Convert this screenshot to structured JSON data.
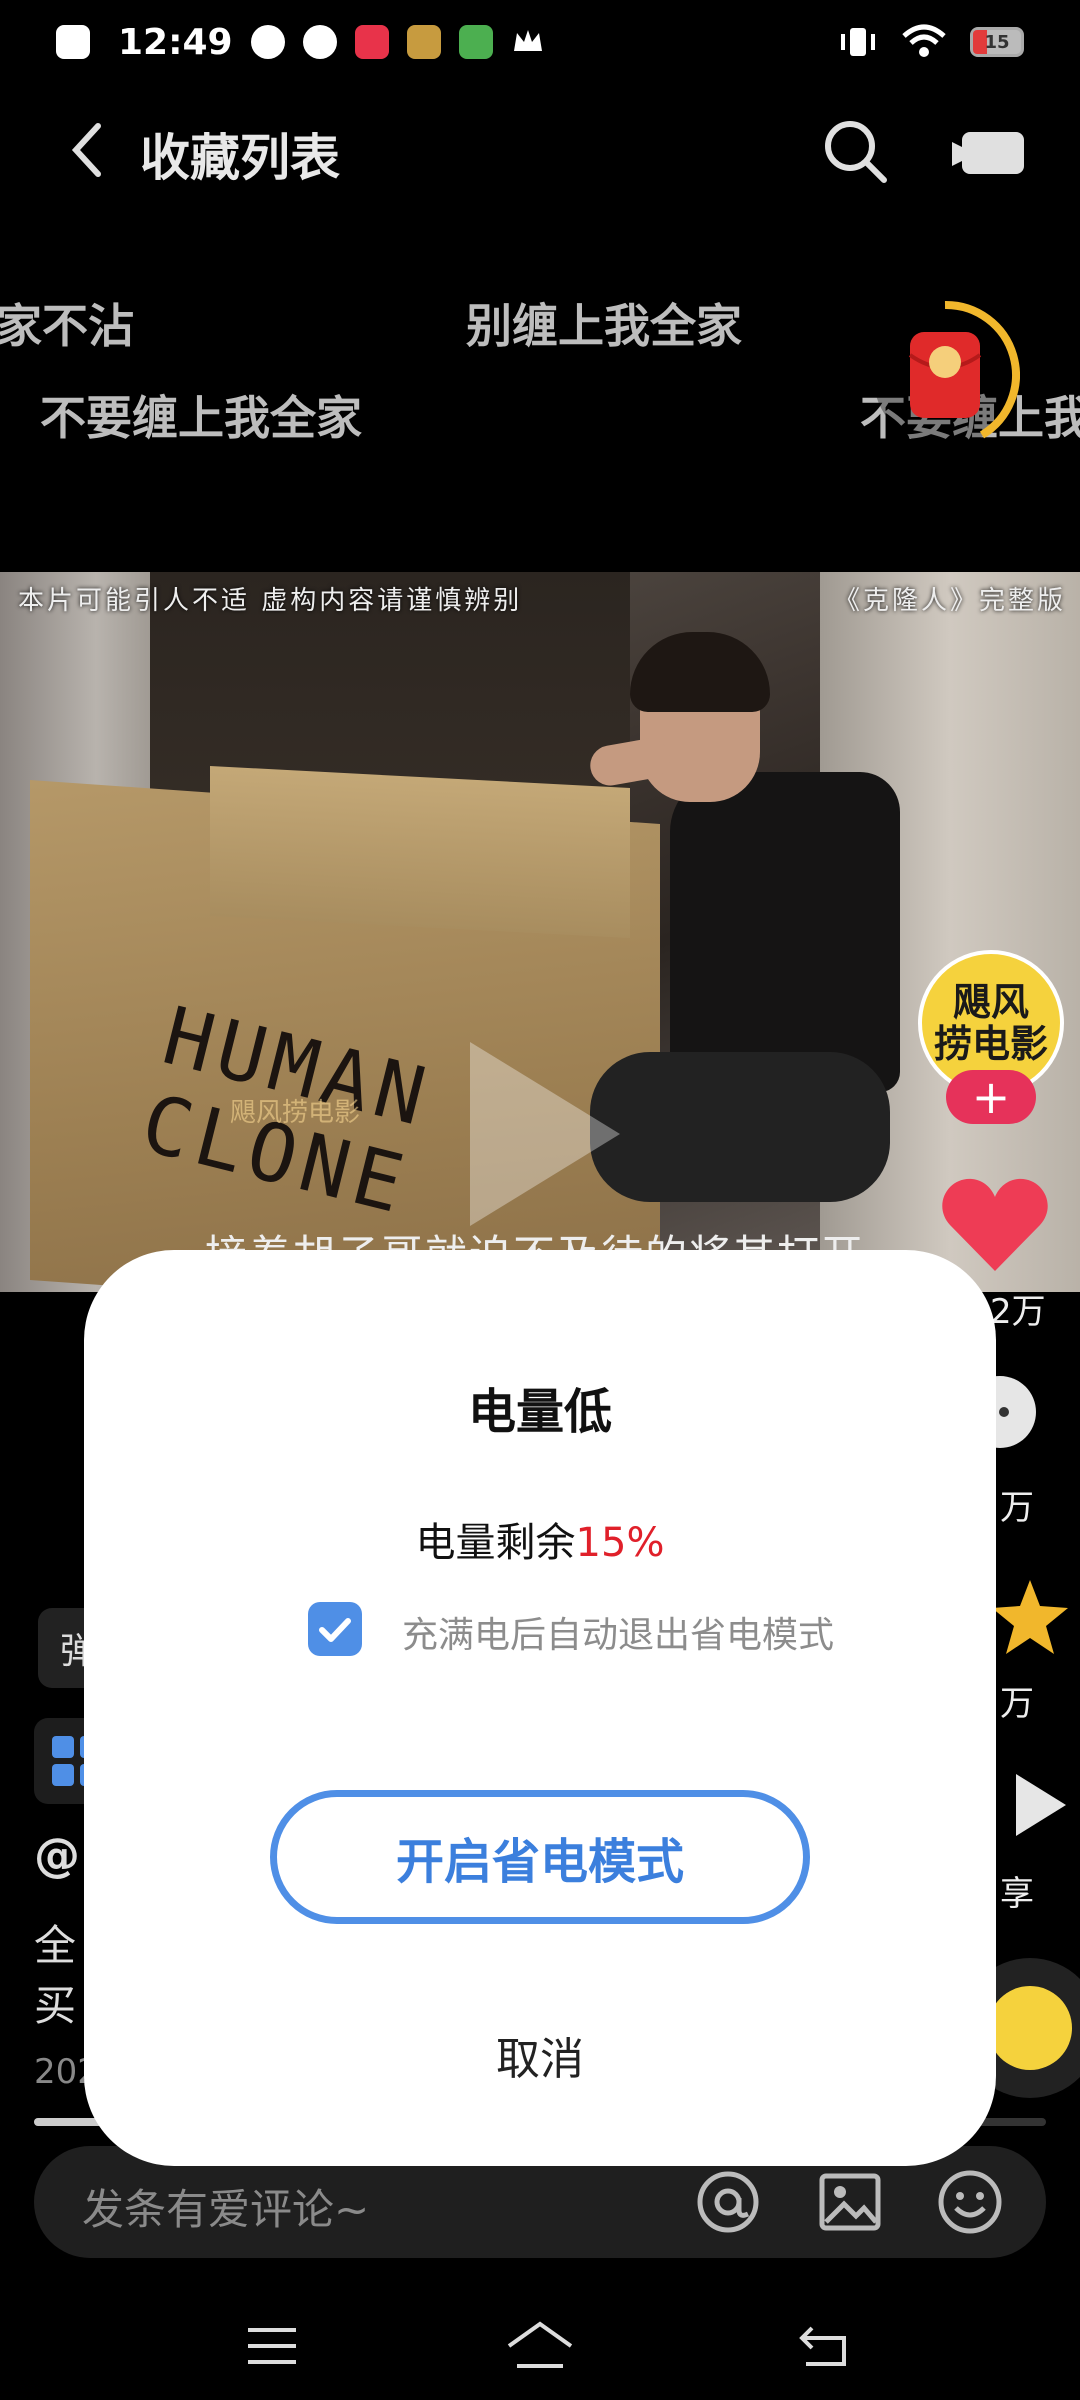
{
  "status_bar": {
    "time": "12:49",
    "battery_level": "15",
    "battery_color": "#e23b3b"
  },
  "header": {
    "title": "收藏列表",
    "back_icon": "chevron-left-icon",
    "search_icon": "search-icon",
    "camera_icon": "video-camera-icon"
  },
  "danmaku": [
    "家不沾",
    "别缠上我全家",
    "不要缠上我全家",
    "不要缠上我"
  ],
  "video": {
    "caption_left": "本片可能引人不适 虚构内容请谨慎辨别",
    "caption_right": "《克隆人》完整版",
    "box_text": "HUMAN CLONE",
    "watermark": "飓风捞电影",
    "subtitle": "接着胡子哥就迫不及待的将其打开"
  },
  "rail": {
    "avatar_text_1": "飓风",
    "avatar_text_2": "捞电影",
    "follow_label": "+",
    "like_count": "2万",
    "comment_count": "万",
    "favorite_count": "万",
    "share_label": "享"
  },
  "info": {
    "danmaku_label": "弹",
    "author": "@",
    "desc_line1": "全",
    "desc_line2": "买",
    "date": "202"
  },
  "comment_bar": {
    "placeholder": "发条有爱评论~"
  },
  "dialog": {
    "title": "电量低",
    "message_prefix": "电量剩余",
    "percent": "15%",
    "checkbox_label": "充满电后自动退出省电模式",
    "checkbox_checked": true,
    "primary_button": "开启省电模式",
    "cancel_button": "取消",
    "accent_color": "#4f8fe6",
    "warning_color": "#e0202a"
  },
  "navbar": {
    "menu_icon": "menu-icon",
    "home_icon": "home-icon",
    "back_icon": "back-icon"
  }
}
